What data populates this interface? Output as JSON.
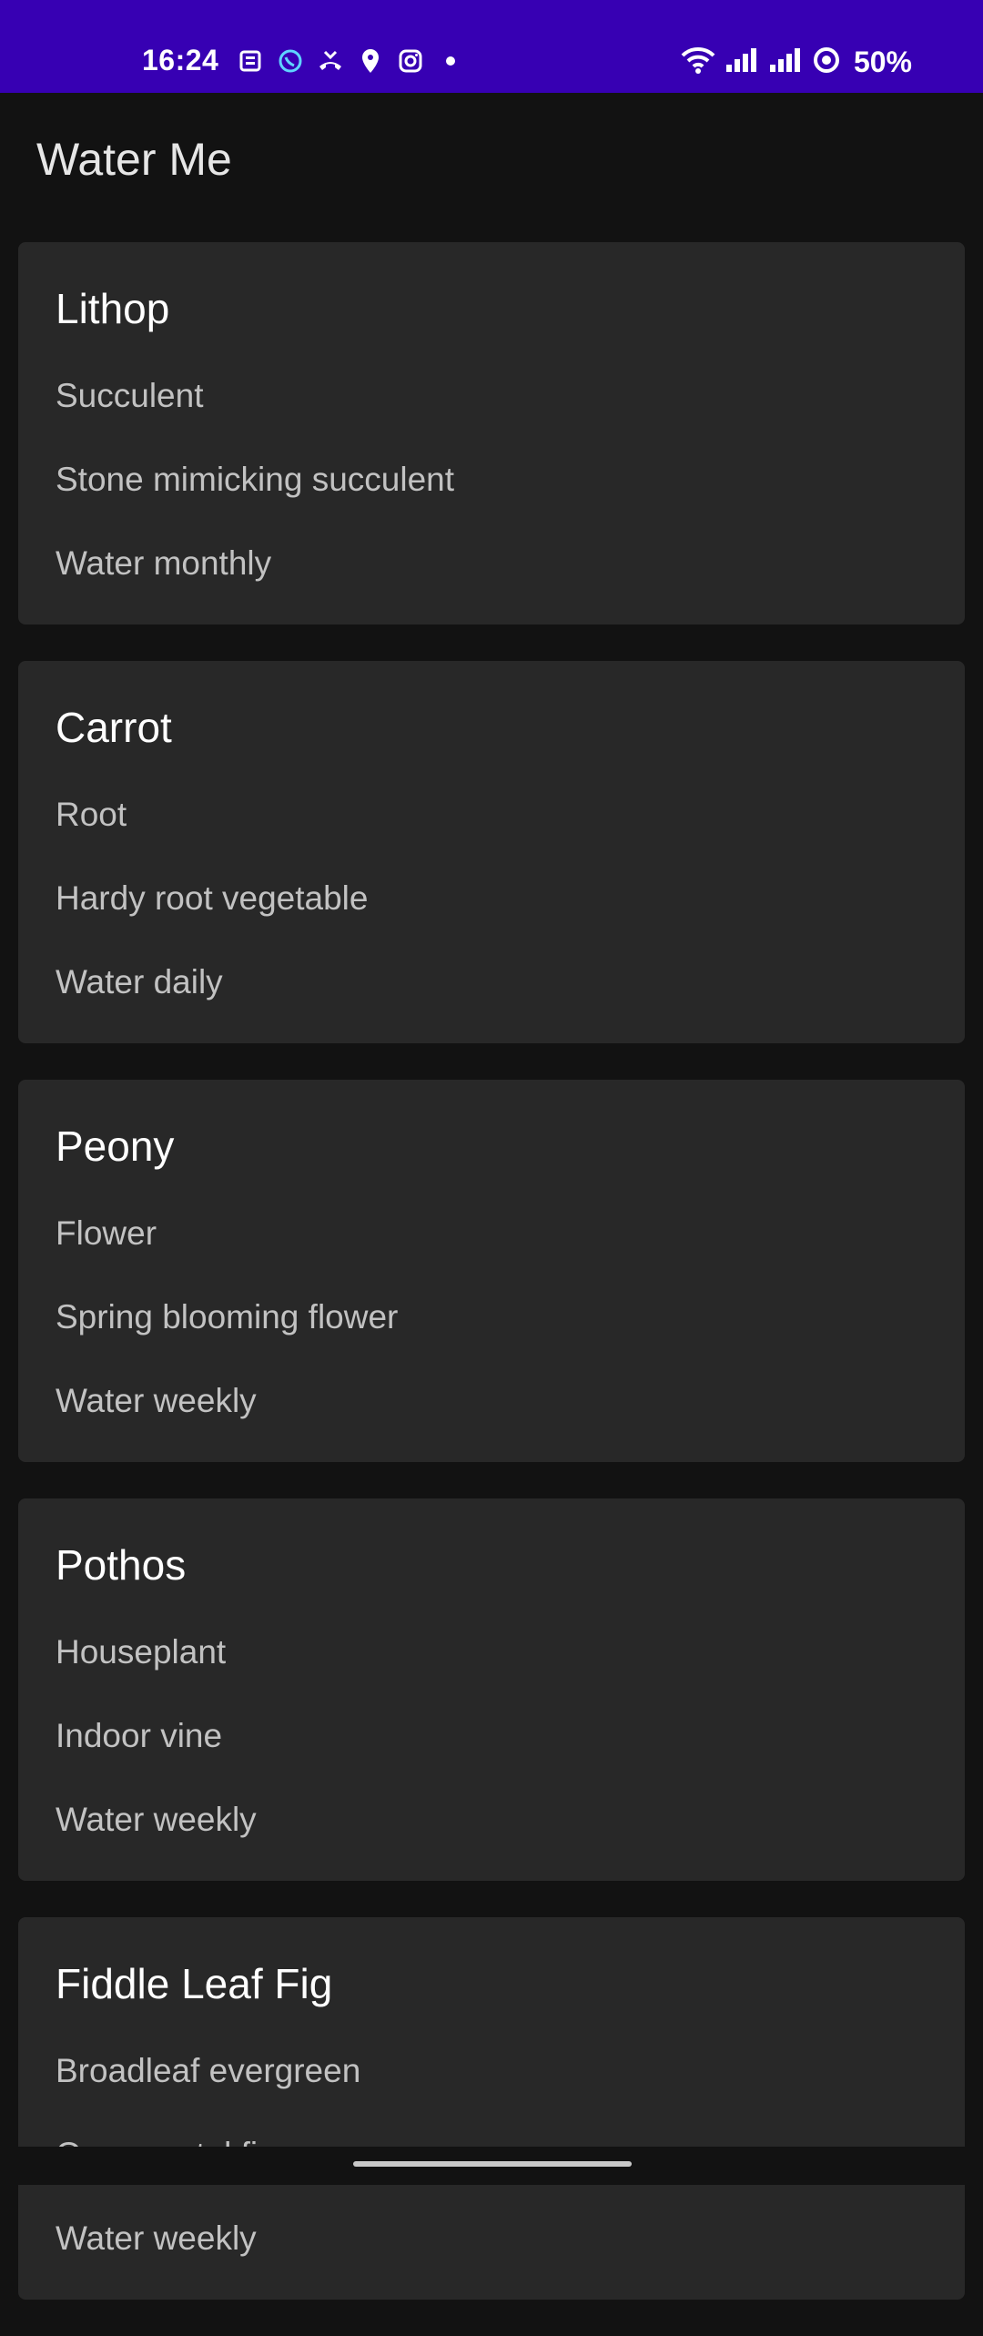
{
  "status_bar": {
    "time": "16:24",
    "battery": "50%",
    "background": "#3700b3",
    "left_icons": [
      "news-icon",
      "whatsapp-icon",
      "missed-call-icon",
      "location-pin-icon",
      "instagram-icon",
      "dot-icon"
    ],
    "right_icons": [
      "wifi-icon",
      "signal-icon",
      "signal-icon",
      "battery-ring-icon"
    ]
  },
  "app_bar": {
    "title": "Water Me"
  },
  "plants": [
    {
      "name": "Lithop",
      "type": "Succulent",
      "description": "Stone mimicking succulent",
      "schedule": "Water monthly"
    },
    {
      "name": "Carrot",
      "type": "Root",
      "description": "Hardy root vegetable",
      "schedule": "Water daily"
    },
    {
      "name": "Peony",
      "type": "Flower",
      "description": "Spring blooming flower",
      "schedule": "Water weekly"
    },
    {
      "name": "Pothos",
      "type": "Houseplant",
      "description": "Indoor vine",
      "schedule": "Water weekly"
    },
    {
      "name": "Fiddle Leaf Fig",
      "type": "Broadleaf evergreen",
      "description": "Ornamental fig",
      "schedule": "Water weekly"
    }
  ]
}
